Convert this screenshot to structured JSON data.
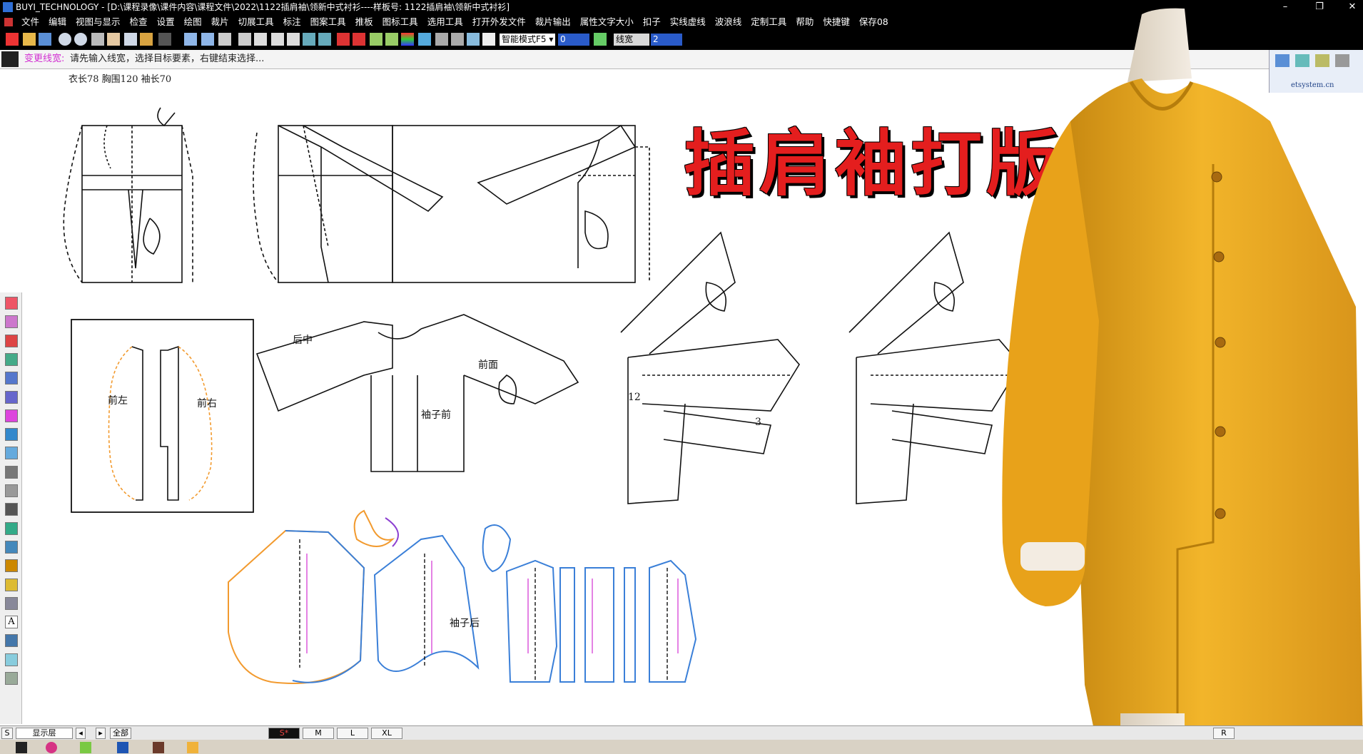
{
  "window": {
    "title": "BUYI_TECHNOLOGY - [D:\\课程录像\\课件内容\\课程文件\\2022\\1122插肩袖\\领新中式衬衫----样板号: 1122插肩袖\\领新中式衬衫]",
    "minimize": "–",
    "restore": "❐",
    "close": "✕"
  },
  "menu": [
    "文件",
    "编辑",
    "视图与显示",
    "检查",
    "设置",
    "绘图",
    "裁片",
    "切展工具",
    "标注",
    "图案工具",
    "推板",
    "图标工具",
    "选用工具",
    "打开外发文件",
    "裁片输出",
    "属性文字大小",
    "扣子",
    "实线虚线",
    "波浪线",
    "定制工具",
    "帮助",
    "快捷键",
    "保存08"
  ],
  "toolbar": {
    "mode_select": "智能模式F5",
    "value_field": "0",
    "line_width_label": "线宽",
    "line_width_value": "2"
  },
  "status": {
    "label": "变更线宽:",
    "message": "请先输入线宽，选择目标要素，右键结束选择..."
  },
  "measurements": "衣长78   胸围120   袖长70",
  "overlay_title": "插肩袖打版",
  "right_panel": {
    "site": "etsystem.cn"
  },
  "pattern_labels": {
    "back_center": "后中",
    "front_left": "前左",
    "front_right": "前右",
    "sleeve_front": "前面",
    "sleeve_body": "袖子前",
    "sleeve_rear": "袖子后",
    "num_12": "12",
    "num_3": "3"
  },
  "bottom": {
    "left_btn": "S",
    "layer_label": "显示层",
    "all_label": "全部",
    "sizes": [
      "S*",
      "M",
      "L",
      "XL"
    ],
    "right_letter": "R"
  },
  "colors": {
    "title_red": "#e41e1e",
    "garment_yellow": "#e8a21a",
    "orange_seam": "#f29a2e",
    "blue_seam": "#3a7fd8",
    "magenta_text": "#d12fd1",
    "status_label": "#d12fd1"
  }
}
